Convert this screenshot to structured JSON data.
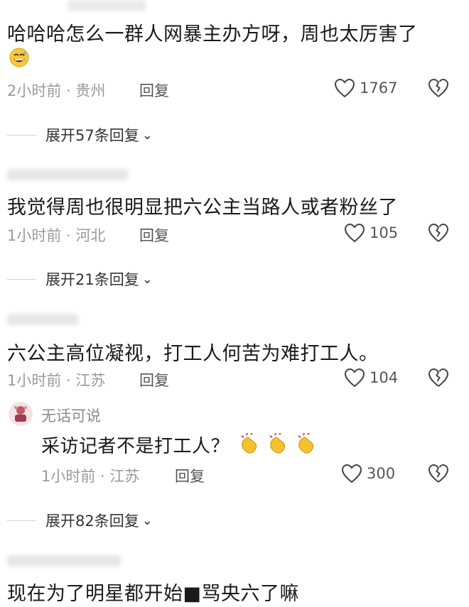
{
  "comments": [
    {
      "author": "",
      "text": "哈哈哈怎么一群人网暴主办方呀，周也太厉害了",
      "emoji": "grinning-sweat-emoji",
      "time": "2小时前",
      "location": "贵州",
      "reply_label": "回复",
      "likes": "1767",
      "expand_label": "展开57条回复"
    },
    {
      "author": "",
      "text": "我觉得周也很明显把六公主当路人或者粉丝了",
      "time": "1小时前",
      "location": "河北",
      "reply_label": "回复",
      "likes": "105",
      "expand_label": "展开21条回复"
    },
    {
      "author": "",
      "text": "六公主高位凝视，打工人何苦为难打工人。",
      "time": "1小时前",
      "location": "江苏",
      "reply_label": "回复",
      "likes": "104",
      "sub_reply": {
        "author": "无话可说",
        "text": "采访记者不是打工人？",
        "emoji": "clapping-hands-emoji",
        "time": "1小时前",
        "location": "江苏",
        "reply_label": "回复",
        "likes": "300"
      },
      "expand_label": "展开82条回复"
    },
    {
      "author": "",
      "text": "现在为了明星都开始■骂央六了嘛"
    }
  ]
}
